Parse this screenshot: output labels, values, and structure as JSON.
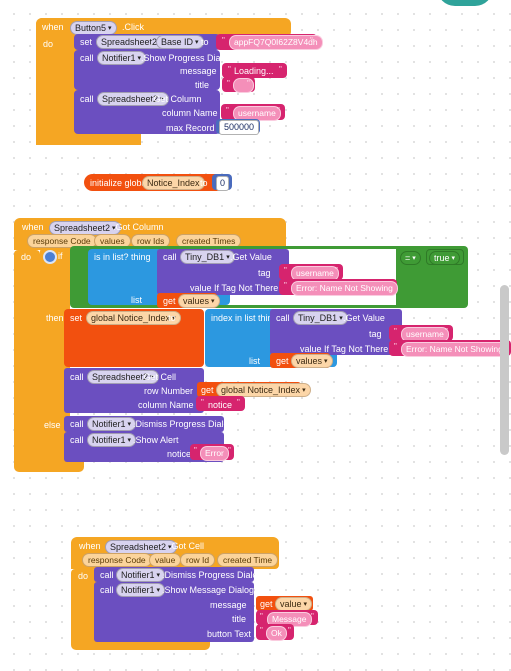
{
  "app": {
    "editor": "MIT App Inventor Blocks Editor",
    "canvas_background": "#ffffff",
    "grid_dot_color": "#e2e2e2"
  },
  "colors": {
    "event": "#f5a623",
    "control": "#f5a623",
    "method_call": "#6b4fc0",
    "text": "#d6246e",
    "variable": "#f2500f",
    "list": "#2c98e0",
    "logic": "#3f9b35",
    "math": "#4a6bbd",
    "teal_accent": "#2fa39a",
    "scrollbar": "#c9c9c9"
  },
  "blocks": {
    "button5_click": {
      "when": "when",
      "component": "Button5",
      "event": ".Click",
      "do": "do",
      "set_keyword": "set",
      "set_component": "Spreadsheet2",
      "set_dot": ".",
      "set_property": "Base ID",
      "set_to": "to",
      "base_id_value": "appFQ7Q0I62Z8V4dh",
      "call1_keyword": "call",
      "call1_component": "Notifier1",
      "call1_method": ".Show Progress Dialog",
      "call1_arg1_label": "message",
      "call1_arg1_value": "Loading...",
      "call1_arg2_label": "title",
      "call1_arg2_value": "",
      "call2_keyword": "call",
      "call2_component": "Spreadsheet2",
      "call2_method": ".Get Column",
      "call2_arg1_label": "column Name",
      "call2_arg1_value": "username",
      "call2_arg2_label": "max Record",
      "call2_arg2_value": "500000"
    },
    "global_init": {
      "keyword": "initialize global",
      "name": "Notice_Index",
      "to": "to",
      "value": "0"
    },
    "got_column": {
      "when": "when",
      "component": "Spreadsheet2",
      "event": ".Got Column",
      "params": [
        "response Code",
        "values",
        "row Ids",
        "created Times"
      ],
      "do": "do",
      "if": "if",
      "then": "then",
      "else": "else",
      "is_in_list_label": "is in list?  thing",
      "is_in_list_list_label": "list",
      "tiny_call_keyword": "call",
      "tiny_component": "Tiny_DB1",
      "tiny_method": ".Get Value",
      "tiny_tag_label": "tag",
      "tiny_tag_value": "username",
      "tiny_fallback_label": "value If Tag Not There",
      "tiny_fallback_value": "Error: Name Not Showing",
      "get_keyword": "get",
      "get_values": "values",
      "compare_op": "=",
      "compare_rhs": "true",
      "set_keyword": "set",
      "set_global": "global Notice_Index",
      "set_to": "to",
      "index_in_list_label": "index in list  thing",
      "index_in_list_list_label": "list",
      "tiny2_call_keyword": "call",
      "tiny2_component": "Tiny_DB1",
      "tiny2_method": ".Get Value",
      "tiny2_tag_label": "tag",
      "tiny2_tag_value": "username",
      "tiny2_fallback_label": "value If Tag Not There",
      "tiny2_fallback_value": "Error: Name Not Showing",
      "get2_keyword": "get",
      "get2_values": "values",
      "getcell_keyword": "call",
      "getcell_component": "Spreadsheet2",
      "getcell_method": ".Get Cell",
      "getcell_row_label": "row Number",
      "getcell_row_get": "get",
      "getcell_row_value": "global Notice_Index",
      "getcell_col_label": "column Name",
      "getcell_col_value": "notice",
      "else_call1_keyword": "call",
      "else_call1_component": "Notifier1",
      "else_call1_method": ".Dismiss Progress Dialog",
      "else_call2_keyword": "call",
      "else_call2_component": "Notifier1",
      "else_call2_method": ".Show Alert",
      "else_notice_label": "notice",
      "else_notice_value": "Error"
    },
    "got_cell": {
      "when": "when",
      "component": "Spreadsheet2",
      "event": ".Got Cell",
      "params": [
        "response Code",
        "value",
        "row Id",
        "created Time"
      ],
      "do": "do",
      "call1_keyword": "call",
      "call1_component": "Notifier1",
      "call1_method": ".Dismiss Progress Dialog",
      "call2_keyword": "call",
      "call2_component": "Notifier1",
      "call2_method": ".Show Message Dialog",
      "msg_label": "message",
      "msg_get": "get",
      "msg_value": "value",
      "title_label": "title",
      "title_value": "Message",
      "button_label": "button Text",
      "button_value": "Ok"
    }
  },
  "dropdown_caret": "▾"
}
